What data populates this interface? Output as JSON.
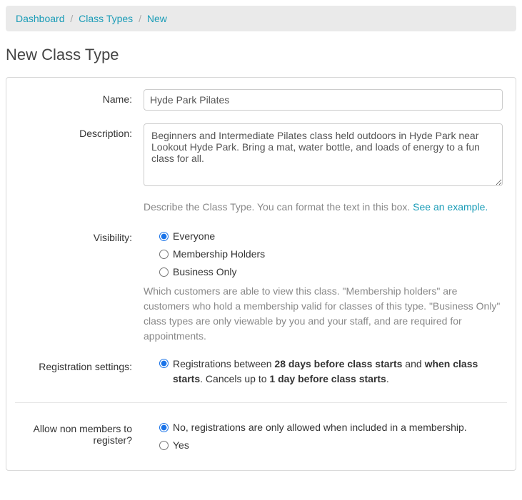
{
  "breadcrumb": {
    "dashboard": "Dashboard",
    "class_types": "Class Types",
    "new": "New"
  },
  "page_title": "New Class Type",
  "labels": {
    "name": "Name:",
    "description": "Description:",
    "visibility": "Visibility:",
    "registration": "Registration settings:",
    "allow_non_members": "Allow non members to register?"
  },
  "fields": {
    "name_value": "Hyde Park Pilates",
    "description_value": "Beginners and Intermediate Pilates class held outdoors in Hyde Park near Lookout Hyde Park. Bring a mat, water bottle, and loads of energy to a fun class for all."
  },
  "help": {
    "description_pre": "Describe the Class Type. You can format the text in this box. ",
    "description_link": "See an example.",
    "visibility": "Which customers are able to view this class. \"Membership holders\" are customers who hold a membership valid for classes of this type. \"Business Only\" class types are only viewable by you and your staff, and are required for appointments."
  },
  "visibility_options": {
    "everyone": "Everyone",
    "members": "Membership Holders",
    "business": "Business Only"
  },
  "registration": {
    "text_pre": "Registrations between ",
    "b1": "28 days before class starts",
    "text_mid": " and ",
    "b2": "when class starts",
    "text_mid2": ". Cancels up to ",
    "b3": "1 day before class starts",
    "text_end": "."
  },
  "non_members": {
    "no": "No, registrations are only allowed when included in a membership.",
    "yes": "Yes"
  }
}
